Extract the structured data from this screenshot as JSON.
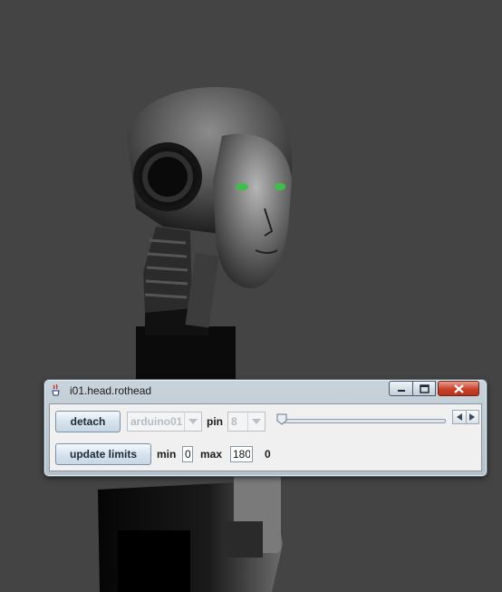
{
  "window": {
    "title": "i01.head.rothead",
    "title_icon": "java-cup-icon",
    "controls": [
      "minimize-icon",
      "maximize-icon",
      "close-icon"
    ]
  },
  "row1": {
    "detach_label": "detach",
    "controller_value": "arduino01",
    "pin_label": "pin",
    "pin_value": "8",
    "slider_position": 0
  },
  "row2": {
    "update_limits_label": "update limits",
    "min_label": "min",
    "min_value": "0",
    "max_label": "max",
    "max_value": "180",
    "current_value": "0"
  },
  "colors": {
    "background": "#444444",
    "eye_glow": "#3fbf4a",
    "close_button": "#c8402b"
  }
}
